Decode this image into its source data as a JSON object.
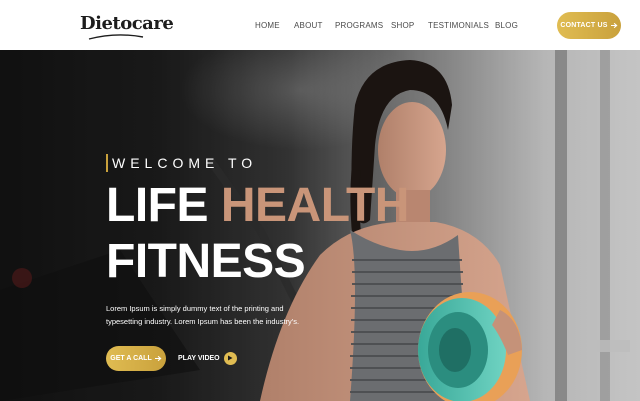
{
  "brand": {
    "name": "Dietocare"
  },
  "nav": {
    "items": [
      "HOME",
      "ABOUT",
      "PROGRAMS",
      "SHOP",
      "TESTIMONIALS",
      "BLOG"
    ],
    "contact_label": "CONTACT US"
  },
  "hero": {
    "eyebrow": "WELCOME TO",
    "title_line1_white": "LIFE",
    "title_line1_accent": "HEALTH",
    "title_line2": "FITNESS",
    "description": "Lorem Ipsum is simply dummy text of the printing and typesetting industry. Lorem Ipsum has been the industry's.",
    "cta_label": "GET A CALL",
    "play_label": "PLAY VIDEO"
  },
  "icons": {
    "contact": "arrow-right-icon",
    "cta": "arrow-right-icon",
    "play": "play-icon"
  },
  "colors": {
    "gold": "#D4AF45",
    "accent_title": "#C99579",
    "nav_text": "#4A4A4A"
  }
}
